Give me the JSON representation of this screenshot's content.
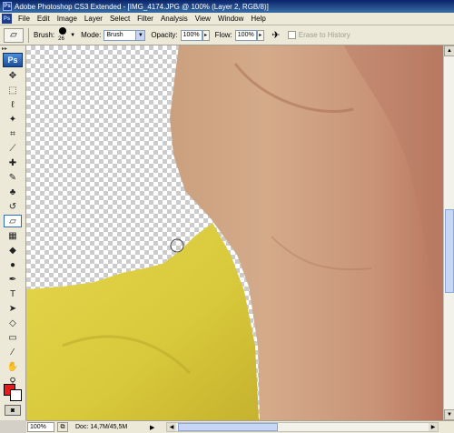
{
  "window": {
    "title": "Adobe Photoshop CS3 Extended - [IMG_4174.JPG @ 100% (Layer 2, RGB/8)]",
    "app_badge": "Ps"
  },
  "menu": [
    "File",
    "Edit",
    "Image",
    "Layer",
    "Select",
    "Filter",
    "Analysis",
    "View",
    "Window",
    "Help"
  ],
  "options": {
    "brush_label": "Brush:",
    "brush_size": "26",
    "mode_label": "Mode:",
    "mode_value": "Brush",
    "opacity_label": "Opacity:",
    "opacity_value": "100%",
    "flow_label": "Flow:",
    "flow_value": "100%",
    "erase_to_history_label": "Erase to History"
  },
  "toolbox": {
    "badge": "Ps",
    "tools": [
      {
        "name": "move-tool",
        "glyph": "✥"
      },
      {
        "name": "marquee-tool",
        "glyph": "⬚"
      },
      {
        "name": "lasso-tool",
        "glyph": "ℓ"
      },
      {
        "name": "magic-wand-tool",
        "glyph": "✦"
      },
      {
        "name": "crop-tool",
        "glyph": "⌗"
      },
      {
        "name": "slice-tool",
        "glyph": "⟋"
      },
      {
        "name": "healing-brush-tool",
        "glyph": "✚"
      },
      {
        "name": "brush-tool",
        "glyph": "✎"
      },
      {
        "name": "clone-stamp-tool",
        "glyph": "♣"
      },
      {
        "name": "history-brush-tool",
        "glyph": "↺"
      },
      {
        "name": "eraser-tool",
        "glyph": "▱"
      },
      {
        "name": "gradient-tool",
        "glyph": "▦"
      },
      {
        "name": "blur-tool",
        "glyph": "◆"
      },
      {
        "name": "dodge-tool",
        "glyph": "●"
      },
      {
        "name": "pen-tool",
        "glyph": "✒"
      },
      {
        "name": "type-tool",
        "glyph": "T"
      },
      {
        "name": "path-selection-tool",
        "glyph": "➤"
      },
      {
        "name": "shape-tool",
        "glyph": "◇"
      },
      {
        "name": "notes-tool",
        "glyph": "▭"
      },
      {
        "name": "eyedropper-tool",
        "glyph": "⁄"
      },
      {
        "name": "hand-tool",
        "glyph": "✋"
      },
      {
        "name": "zoom-tool",
        "glyph": "⚲"
      }
    ],
    "active_tool": "eraser-tool",
    "foreground_color": "#e8191b",
    "background_color": "#ffffff"
  },
  "status": {
    "zoom": "100%",
    "doc": "Doc: 14,7M/45,5M"
  }
}
